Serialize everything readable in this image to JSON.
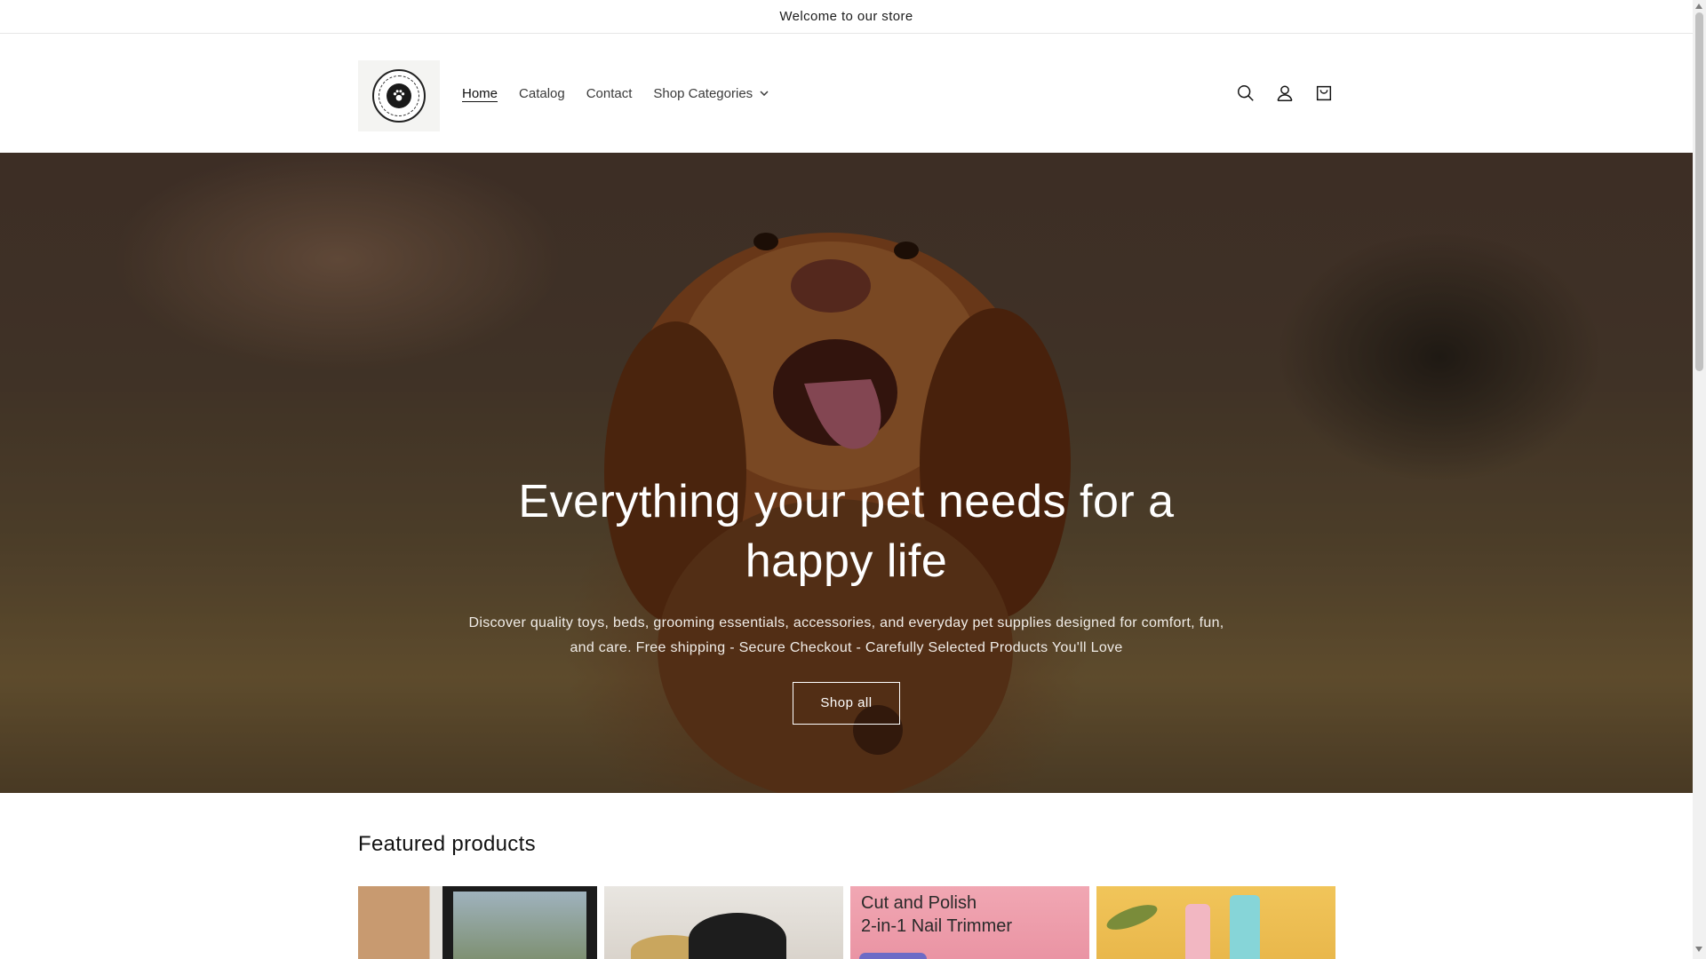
{
  "announcement": {
    "text": "Welcome to our store"
  },
  "header": {
    "nav": [
      {
        "label": "Home",
        "active": true
      },
      {
        "label": "Catalog",
        "active": false
      },
      {
        "label": "Contact",
        "active": false
      },
      {
        "label": "Shop Categories",
        "active": false,
        "dropdown": true
      }
    ],
    "icons": [
      "search-icon",
      "account-icon",
      "cart-icon"
    ]
  },
  "hero": {
    "title": "Everything your pet needs for a happy life",
    "subtitle": "Discover quality toys, beds, grooming essentials, accessories, and everyday pet supplies designed for comfort, fun, and care. Free shipping - Secure Checkout - Carefully Selected Products You'll Love",
    "button_label": "Shop all"
  },
  "featured": {
    "title": "Featured products",
    "cards": [
      {
        "image_text": ""
      },
      {
        "image_text": ""
      },
      {
        "image_text": "Cut and Polish\n2-in-1 Nail Trimmer"
      },
      {
        "image_text": ""
      }
    ]
  },
  "colors": {
    "text": "#121212",
    "border": "#e6e6e6",
    "hero_text": "#ffffff"
  }
}
